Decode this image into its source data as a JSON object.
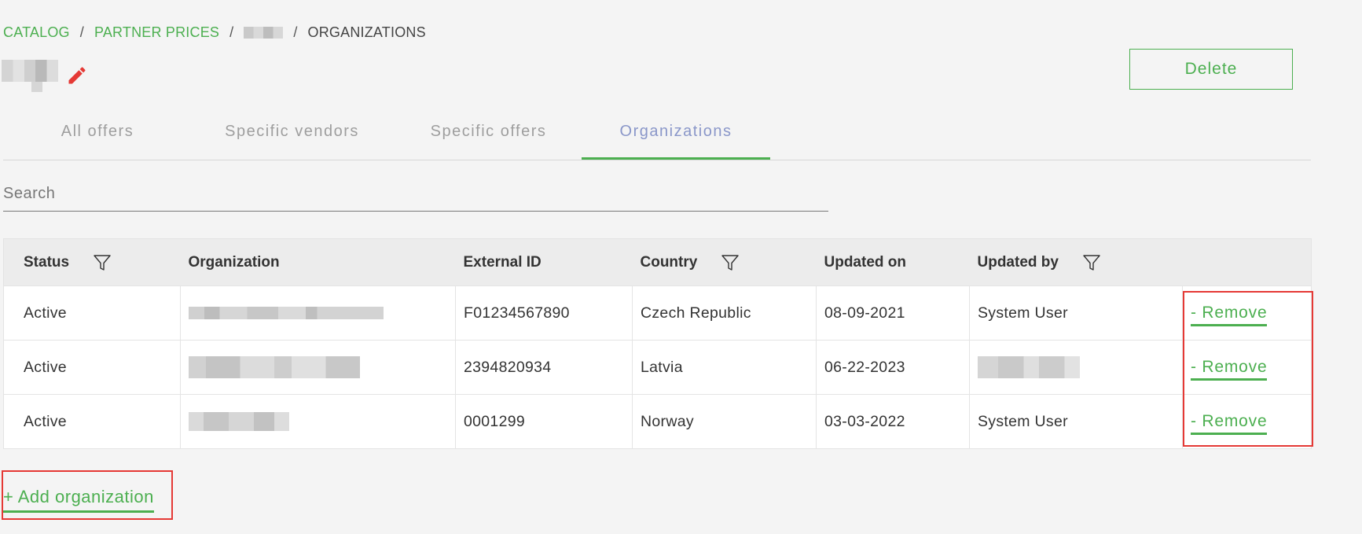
{
  "breadcrumb": {
    "catalog": "CATALOG",
    "partner_prices": "PARTNER PRICES",
    "current": "ORGANIZATIONS",
    "separator": "/"
  },
  "header": {
    "delete_label": "Delete"
  },
  "tabs": [
    {
      "label": "All offers",
      "active": false
    },
    {
      "label": "Specific vendors",
      "active": false
    },
    {
      "label": "Specific offers",
      "active": false
    },
    {
      "label": "Organizations",
      "active": true
    }
  ],
  "search": {
    "placeholder": "Search",
    "value": ""
  },
  "table": {
    "columns": [
      "Status",
      "Organization",
      "External ID",
      "Country",
      "Updated on",
      "Updated by",
      ""
    ],
    "rows": [
      {
        "status": "Active",
        "external_id": "F01234567890",
        "country": "Czech Republic",
        "updated_on": "08-09-2021",
        "updated_by": "System User",
        "action": "- Remove"
      },
      {
        "status": "Active",
        "external_id": "2394820934",
        "country": "Latvia",
        "updated_on": "06-22-2023",
        "updated_by": "",
        "action": "- Remove"
      },
      {
        "status": "Active",
        "external_id": "0001299",
        "country": "Norway",
        "updated_on": "03-03-2022",
        "updated_by": "System User",
        "action": "- Remove"
      }
    ]
  },
  "footer": {
    "add_organization_label": "+ Add organization"
  },
  "colors": {
    "accent": "#4caf50",
    "active_tab_text": "#8a97c9",
    "edit_icon": "#e53935",
    "highlight_box": "#e53935"
  },
  "icons": {
    "edit": "pencil-icon",
    "filter": "filter-icon"
  }
}
